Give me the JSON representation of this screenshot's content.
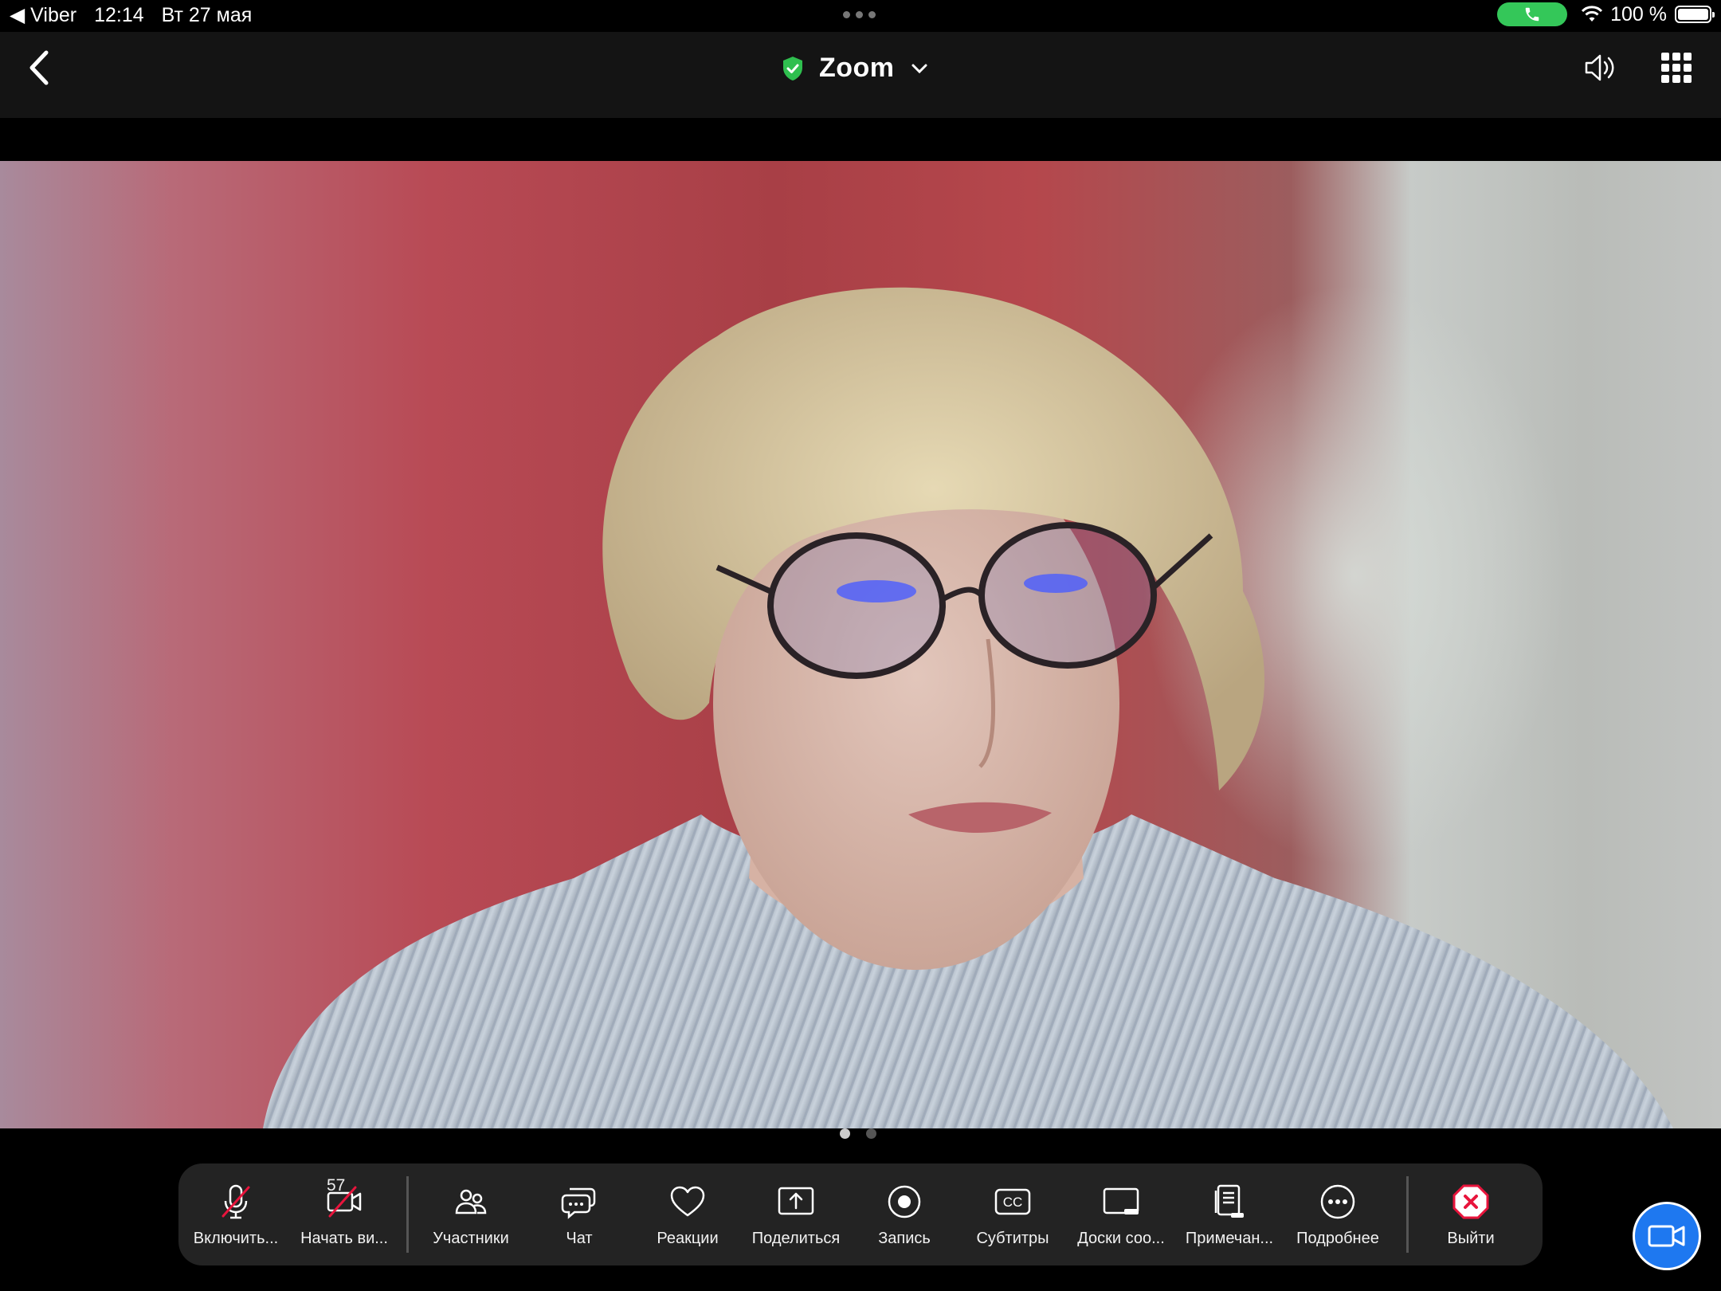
{
  "status_bar": {
    "back_app": "◀ Viber",
    "time": "12:14",
    "date": "Вт 27 мая",
    "battery": "100 %",
    "call_active_color": "#34c759"
  },
  "nav": {
    "title": "Zoom",
    "icons": [
      "back-chevron-icon",
      "shield-check-icon",
      "chevron-down-icon",
      "speaker-icon",
      "grid-icon"
    ]
  },
  "meeting": {
    "participants_count": "57",
    "page_indicator": {
      "pages": 2,
      "current": 1
    }
  },
  "toolbar": {
    "mic": "Включить...",
    "video": "Начать ви...",
    "participants": "Участники",
    "chat": "Чат",
    "reactions": "Реакции",
    "share": "Поделиться",
    "record": "Запись",
    "captions": "Субтитры",
    "whiteboards": "Доски соо...",
    "notes": "Примечан...",
    "more": "Подробнее",
    "leave": "Выйти"
  },
  "colors": {
    "accent": "#1e78f0",
    "leave_red": "#e8143c",
    "muted_slash": "#e8143c",
    "secure_green": "#2fbf4f"
  }
}
